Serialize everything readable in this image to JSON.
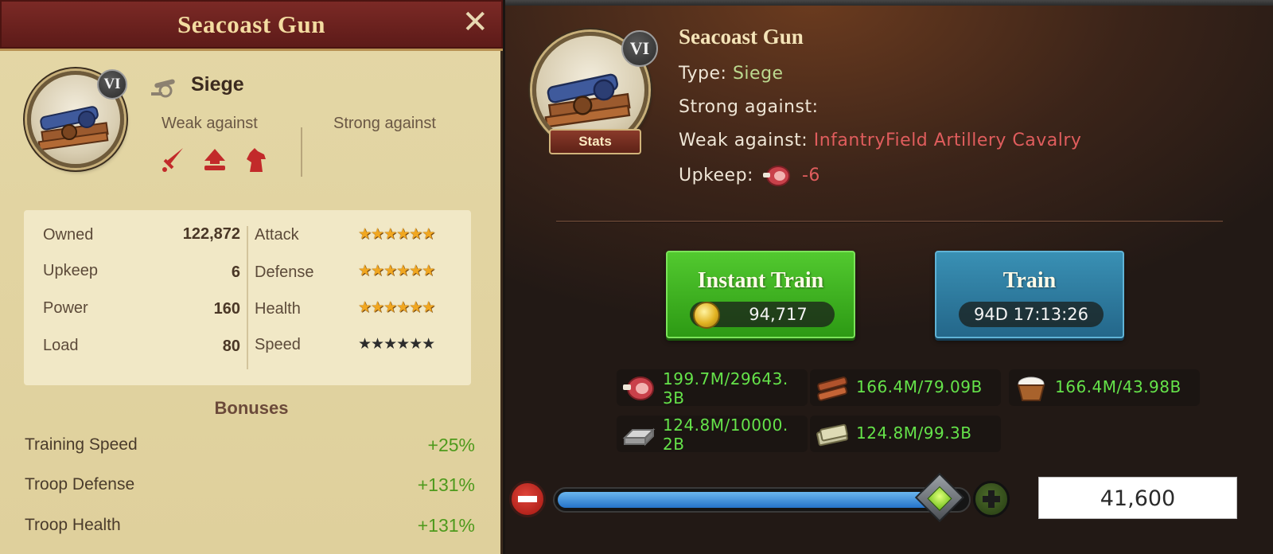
{
  "left_panel": {
    "title": "Seacoast Gun",
    "close_label": "✕",
    "tier": "VI",
    "type": "Siege",
    "weak_against_label": "Weak against",
    "strong_against_label": "Strong against",
    "weak_icons": [
      "sword-icon",
      "field-artillery-icon",
      "horse-icon"
    ],
    "stats": [
      {
        "label": "Owned",
        "value": "122,872"
      },
      {
        "label": "Upkeep",
        "value": "6"
      },
      {
        "label": "Power",
        "value": "160"
      },
      {
        "label": "Load",
        "value": "80"
      }
    ],
    "ratings": [
      {
        "label": "Attack",
        "stars": "★★★★★★",
        "color": "#f1a720"
      },
      {
        "label": "Defense",
        "stars": "★★★★★★",
        "color": "#f1a720"
      },
      {
        "label": "Health",
        "stars": "★★★★★★",
        "color": "#f1a720"
      },
      {
        "label": "Speed",
        "stars": "★★★★★★",
        "color": "#2c2c2c"
      }
    ],
    "bonuses_title": "Bonuses",
    "bonuses": [
      {
        "label": "Training Speed",
        "value": "+25%"
      },
      {
        "label": "Troop Defense",
        "value": "+131%"
      },
      {
        "label": "Troop Health",
        "value": "+131%"
      }
    ]
  },
  "right_panel": {
    "tier": "VI",
    "stats_button": "Stats",
    "name": "Seacoast Gun",
    "type_label": "Type:",
    "type_value": "Siege",
    "strong_label": "Strong against:",
    "weak_label": "Weak against:",
    "weak_value": "InfantryField Artillery Cavalry",
    "upkeep_label": "Upkeep:",
    "upkeep_value": "-6",
    "instant_train": {
      "label": "Instant Train",
      "cost": "94,717"
    },
    "train": {
      "label": "Train",
      "time": "94D 17:13:26"
    },
    "resources": [
      {
        "icon": "meat-icon",
        "text": "199.7M/29643.3B"
      },
      {
        "icon": "wood-icon",
        "text": "166.4M/79.09B"
      },
      {
        "icon": "food-basket-icon",
        "text": "166.4M/43.98B"
      },
      {
        "icon": "iron-icon",
        "text": "124.8M/10000.2B"
      },
      {
        "icon": "silver-icon",
        "text": "124.8M/99.3B"
      }
    ],
    "quantity": "41,600",
    "slider_fraction": 0.94
  },
  "colors": {
    "green_text": "#65e34a",
    "bonus_green": "#4e9a1c",
    "weak_red": "#e05d5d"
  }
}
